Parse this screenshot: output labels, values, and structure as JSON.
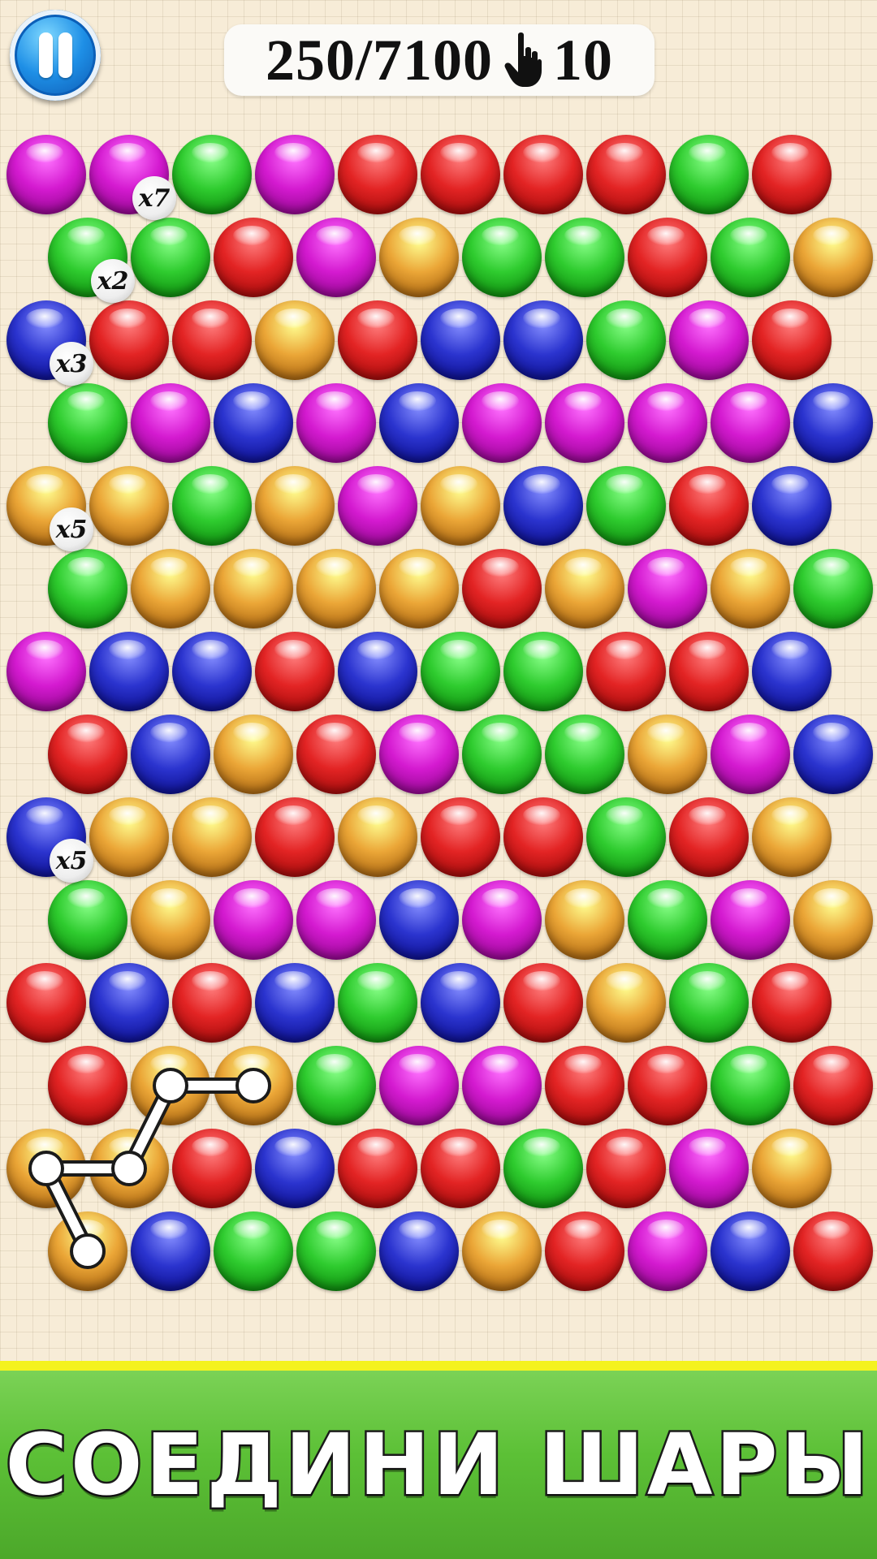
{
  "hud": {
    "score": "250/7100",
    "moves": "10",
    "pause_icon": "pause-icon",
    "moves_icon": "hand-pointer-icon"
  },
  "colors": {
    "purple": "#d41ad0",
    "green": "#2fcc2f",
    "red": "#e32424",
    "orange": "#eba637",
    "blue": "#2b34cf"
  },
  "board": {
    "rows": [
      [
        "purple",
        "purple",
        "green",
        "purple",
        "red",
        "red",
        "red",
        "red",
        "green",
        "red"
      ],
      [
        "green",
        "green",
        "red",
        "purple",
        "orange",
        "green",
        "green",
        "red",
        "green",
        "orange"
      ],
      [
        "blue",
        "red",
        "red",
        "orange",
        "red",
        "blue",
        "blue",
        "green",
        "purple",
        "red"
      ],
      [
        "green",
        "purple",
        "blue",
        "purple",
        "blue",
        "purple",
        "purple",
        "purple",
        "purple",
        "blue"
      ],
      [
        "orange",
        "orange",
        "green",
        "orange",
        "purple",
        "orange",
        "blue",
        "green",
        "red",
        "blue"
      ],
      [
        "green",
        "orange",
        "orange",
        "orange",
        "orange",
        "red",
        "orange",
        "purple",
        "orange",
        "green"
      ],
      [
        "purple",
        "blue",
        "blue",
        "red",
        "blue",
        "green",
        "green",
        "red",
        "red",
        "blue"
      ],
      [
        "red",
        "blue",
        "orange",
        "red",
        "purple",
        "green",
        "green",
        "orange",
        "purple",
        "blue"
      ],
      [
        "blue",
        "orange",
        "orange",
        "red",
        "orange",
        "red",
        "red",
        "green",
        "red",
        "orange"
      ],
      [
        "green",
        "orange",
        "purple",
        "purple",
        "blue",
        "purple",
        "orange",
        "green",
        "purple",
        "orange"
      ],
      [
        "red",
        "blue",
        "red",
        "blue",
        "green",
        "blue",
        "red",
        "orange",
        "green",
        "red"
      ],
      [
        "red",
        "orange",
        "orange",
        "green",
        "purple",
        "purple",
        "red",
        "red",
        "green",
        "red"
      ],
      [
        "orange",
        "orange",
        "red",
        "blue",
        "red",
        "red",
        "green",
        "red",
        "purple",
        "orange"
      ],
      [
        "orange",
        "blue",
        "green",
        "green",
        "blue",
        "orange",
        "red",
        "purple",
        "blue",
        "red"
      ]
    ],
    "multipliers": [
      {
        "row": 0,
        "col": 1,
        "label": "x7"
      },
      {
        "row": 1,
        "col": 0,
        "label": "x2"
      },
      {
        "row": 2,
        "col": 0,
        "label": "x3"
      },
      {
        "row": 4,
        "col": 0,
        "label": "x5"
      },
      {
        "row": 8,
        "col": 0,
        "label": "x5"
      }
    ],
    "selected_path": [
      {
        "row": 11,
        "col": 2
      },
      {
        "row": 11,
        "col": 1
      },
      {
        "row": 12,
        "col": 1
      },
      {
        "row": 12,
        "col": 0
      },
      {
        "row": 13,
        "col": 0
      }
    ]
  },
  "footer": {
    "text": "СОЕДИНИ ШАРЫ"
  }
}
